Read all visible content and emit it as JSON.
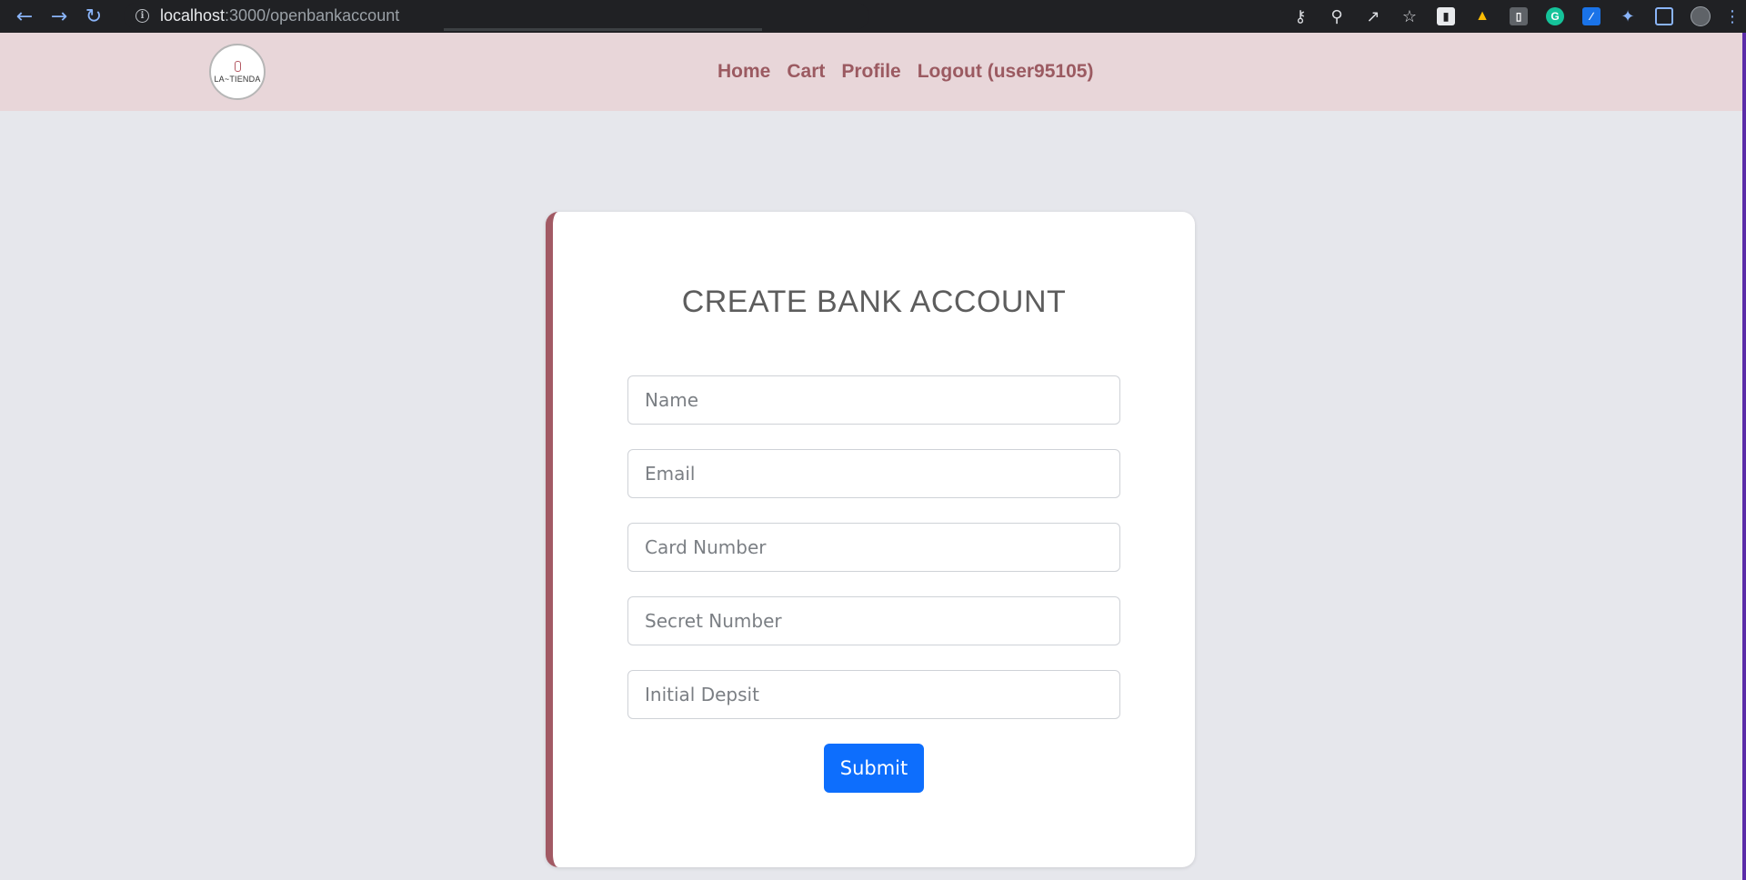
{
  "browser": {
    "url_host": "localhost",
    "url_rest": ":3000/openbankaccount",
    "icons": [
      "back-arrow-icon",
      "forward-arrow-icon",
      "reload-icon",
      "info-icon",
      "key-icon",
      "zoom-out-icon",
      "share-icon",
      "star-icon",
      "extension-puzzle-icon",
      "side-panel-icon",
      "menu-dots-icon"
    ]
  },
  "navbar": {
    "logo_text": "LA~TIENDA",
    "links": [
      "Home",
      "Cart",
      "Profile",
      "Logout (user95105)"
    ]
  },
  "form": {
    "title": "CREATE BANK ACCOUNT",
    "placeholders": {
      "name": "Name",
      "email": "Email",
      "card_number": "Card Number",
      "secret_number": "Secret Number",
      "initial_deposit": "Initial Depsit"
    },
    "submit_label": "Submit"
  },
  "colors": {
    "navbar_bg": "#e8d6d9",
    "nav_link": "#9b5a61",
    "card_accent": "#a25a64",
    "submit_bg": "#0d6efd",
    "page_bg": "#e6e7ec"
  }
}
